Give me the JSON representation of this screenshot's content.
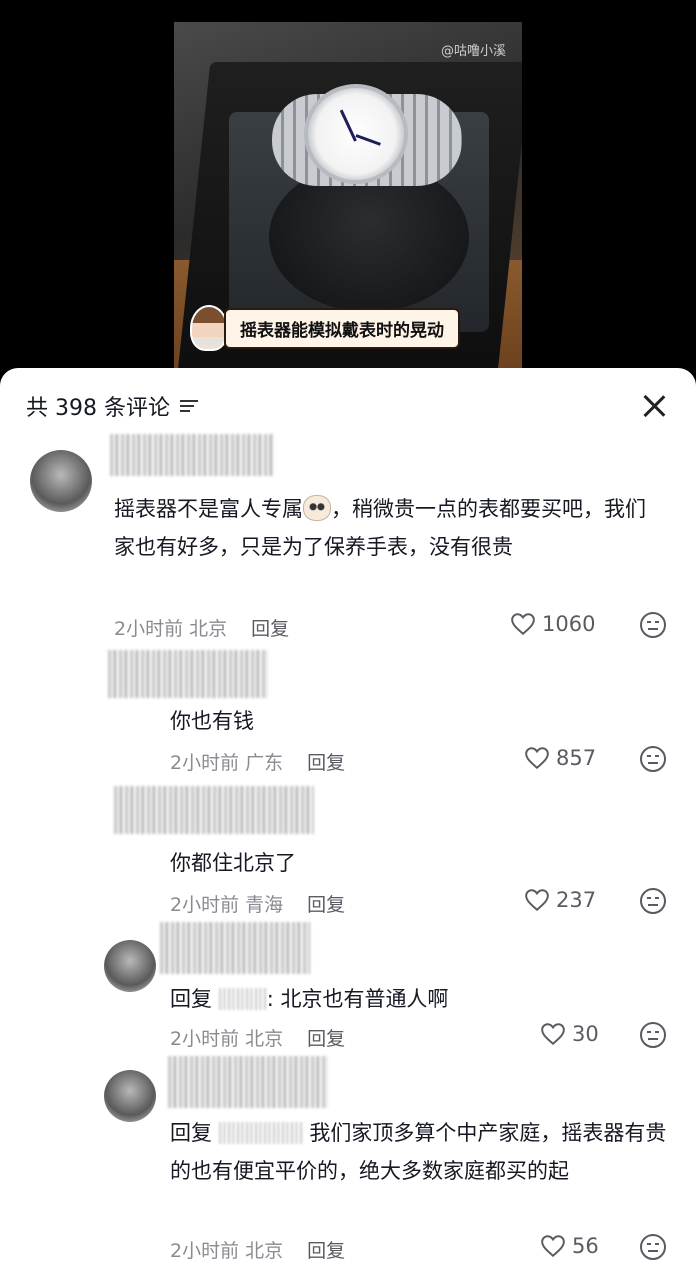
{
  "video": {
    "watermark": "@咕噜小溪",
    "caption": "摇表器能模拟戴表时的晃动"
  },
  "panel": {
    "title": "共 398 条评论"
  },
  "comments": [
    {
      "text_part1": "摇表器不是富人专属",
      "text_part2": "，稍微贵一点的表都要买吧，我们家也有好多，只是为了保养手表，没有很贵",
      "time": "2小时前",
      "location": "北京",
      "reply_label": "回复",
      "likes": "1060"
    },
    {
      "text": "你也有钱",
      "time": "2小时前",
      "location": "广东",
      "reply_label": "回复",
      "likes": "857"
    },
    {
      "text": "你都住北京了",
      "time": "2小时前",
      "location": "青海",
      "reply_label": "回复",
      "likes": "237"
    },
    {
      "reply_prefix": "回复",
      "text": ": 北京也有普通人啊",
      "time": "2小时前",
      "location": "北京",
      "reply_label": "回复",
      "likes": "30"
    },
    {
      "reply_prefix": "回复",
      "text": "我们家顶多算个中产家庭，摇表器有贵的也有便宜平价的，绝大多数家庭都买的起",
      "time": "2小时前",
      "location": "北京",
      "reply_label": "回复",
      "likes": "56"
    }
  ],
  "icons": {
    "close": "close-icon",
    "filter": "filter-icon",
    "heart": "heart-icon",
    "dislike": "dislike-icon"
  }
}
